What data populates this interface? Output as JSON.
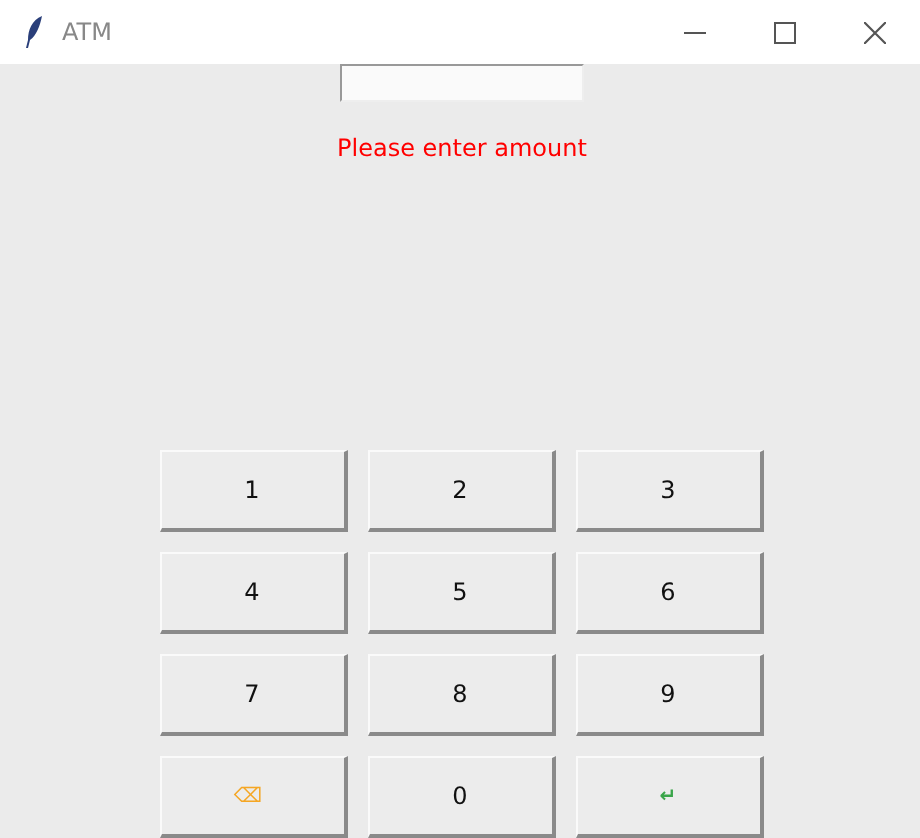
{
  "window": {
    "title": "ATM"
  },
  "message": {
    "text": "Please enter amount",
    "color": "#ff0000"
  },
  "keys": [
    {
      "label": "1"
    },
    {
      "label": "2"
    },
    {
      "label": "3"
    },
    {
      "label": "4"
    },
    {
      "label": "5"
    },
    {
      "label": "6"
    },
    {
      "label": "7"
    },
    {
      "label": "8"
    },
    {
      "label": "9"
    },
    {
      "label": "⌫",
      "kind": "backspace",
      "color": "#f5a623"
    },
    {
      "label": "0"
    },
    {
      "label": "↵",
      "kind": "enter",
      "color": "#3aa54a"
    }
  ]
}
